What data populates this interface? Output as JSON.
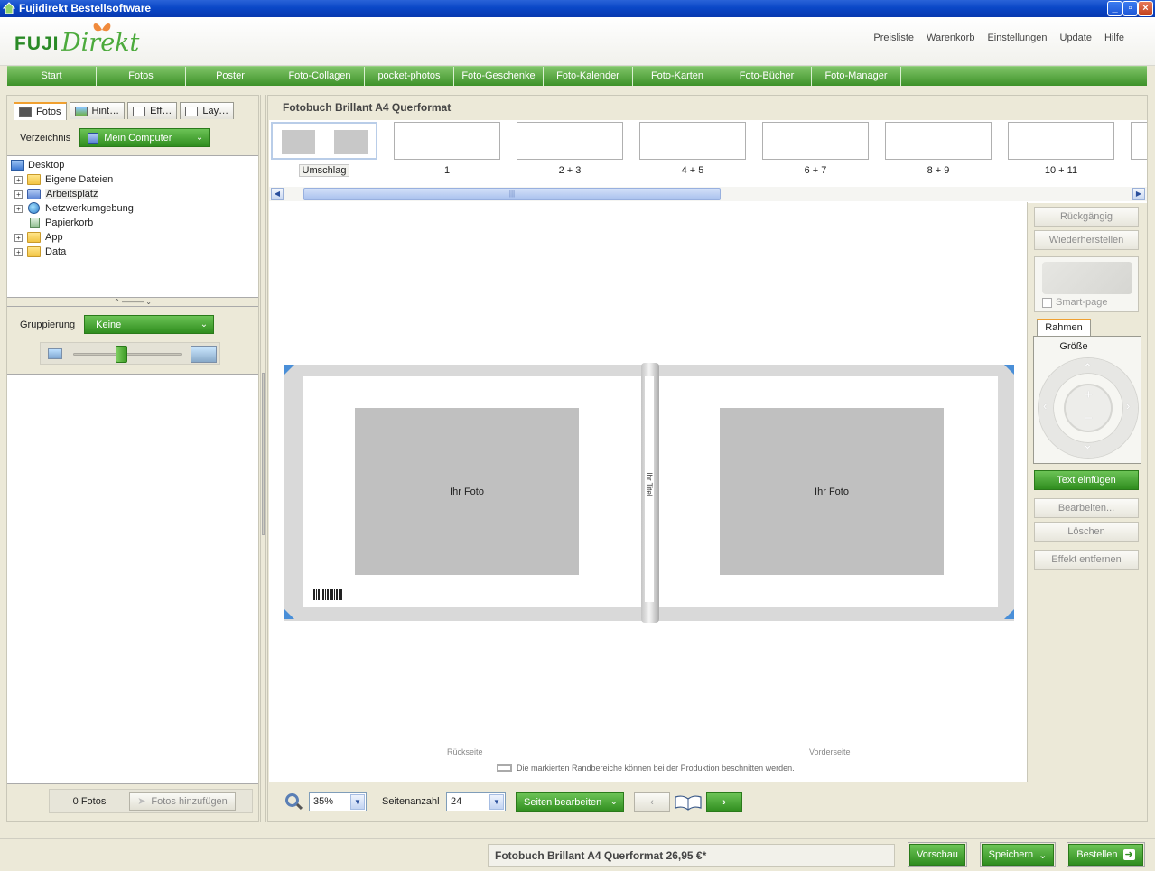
{
  "window": {
    "title": "Fujidirekt Bestellsoftware"
  },
  "header": {
    "logo_fuji": "FUJI",
    "logo_direkt": "Direkt",
    "links": [
      "Preisliste",
      "Warenkorb",
      "Einstellungen",
      "Update",
      "Hilfe"
    ]
  },
  "nav": [
    "Start",
    "Fotos",
    "Poster",
    "Foto-Collagen",
    "pocket-photos",
    "Foto-Geschenke",
    "Foto-Kalender",
    "Foto-Karten",
    "Foto-Bücher",
    "Foto-Manager"
  ],
  "left": {
    "tabs": [
      "Fotos",
      "Hint…",
      "Eff…",
      "Lay…"
    ],
    "directory_label": "Verzeichnis",
    "directory_value": "Mein Computer",
    "tree": [
      "Desktop",
      "Eigene Dateien",
      "Arbeitsplatz",
      "Netzwerkumgebung",
      "Papierkorb",
      "App",
      "Data"
    ],
    "grouping_label": "Gruppierung",
    "grouping_value": "Keine",
    "photo_count": "0 Fotos",
    "add_photos": "Fotos hinzufügen"
  },
  "main": {
    "title": "Fotobuch Brillant A4 Querformat",
    "thumbnails": [
      "Umschlag",
      "1",
      "2 + 3",
      "4 + 5",
      "6 + 7",
      "8 + 9",
      "10 + 11"
    ],
    "photo_placeholder": "Ihr Foto",
    "spine_title": "Ihr Titel",
    "back_label": "Rückseite",
    "front_label": "Vorderseite",
    "cut_note": "Die markierten Randbereiche können bei der Produktion beschnitten werden.",
    "zoom_value": "35%",
    "page_count_label": "Seitenanzahl",
    "page_count_value": "24",
    "edit_pages": "Seiten bearbeiten"
  },
  "tools": {
    "undo": "Rückgängig",
    "redo": "Wiederherstellen",
    "smart_page": "Smart-page",
    "frame_tab": "Rahmen",
    "size_label": "Größe",
    "insert_text": "Text einfügen",
    "edit": "Bearbeiten...",
    "delete": "Löschen",
    "remove_effect": "Effekt entfernen"
  },
  "status": {
    "price": "Fotobuch Brillant A4 Querformat 26,95 €*",
    "preview": "Vorschau",
    "save": "Speichern",
    "order": "Bestellen"
  },
  "colors": {
    "accent_green": "#3d9128",
    "titlebar_blue": "#0a47c7",
    "placeholder_grey": "#c0c0c0"
  }
}
